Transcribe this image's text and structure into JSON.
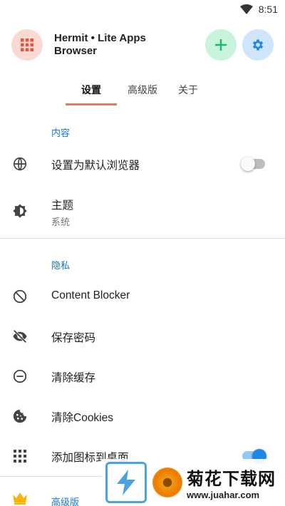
{
  "status": {
    "time": "8:51"
  },
  "app": {
    "title": "Hermit • Lite Apps Browser"
  },
  "tabs": [
    {
      "label": "设置"
    },
    {
      "label": "高级版"
    },
    {
      "label": "关于"
    }
  ],
  "sections": {
    "content": {
      "label": "内容",
      "items": {
        "default_browser": {
          "label": "设置为默认浏览器",
          "toggle": false
        },
        "theme": {
          "label": "主题",
          "value": "系统"
        }
      }
    },
    "privacy": {
      "label": "隐私",
      "items": {
        "content_blocker": {
          "label": "Content Blocker"
        },
        "save_passwords": {
          "label": "保存密码"
        },
        "clear_cache": {
          "label": "清除缓存"
        },
        "clear_cookies": {
          "label": "清除Cookies"
        },
        "add_icon": {
          "label": "添加图标到桌面",
          "toggle": true
        }
      }
    },
    "premium": {
      "label": "高级版"
    }
  },
  "watermark": {
    "text": "菊花下载网",
    "url": "www.juahar.com"
  },
  "colors": {
    "accent": "#1976d2",
    "tab_indicator": "#e07b63",
    "premium": "#f5b400"
  }
}
